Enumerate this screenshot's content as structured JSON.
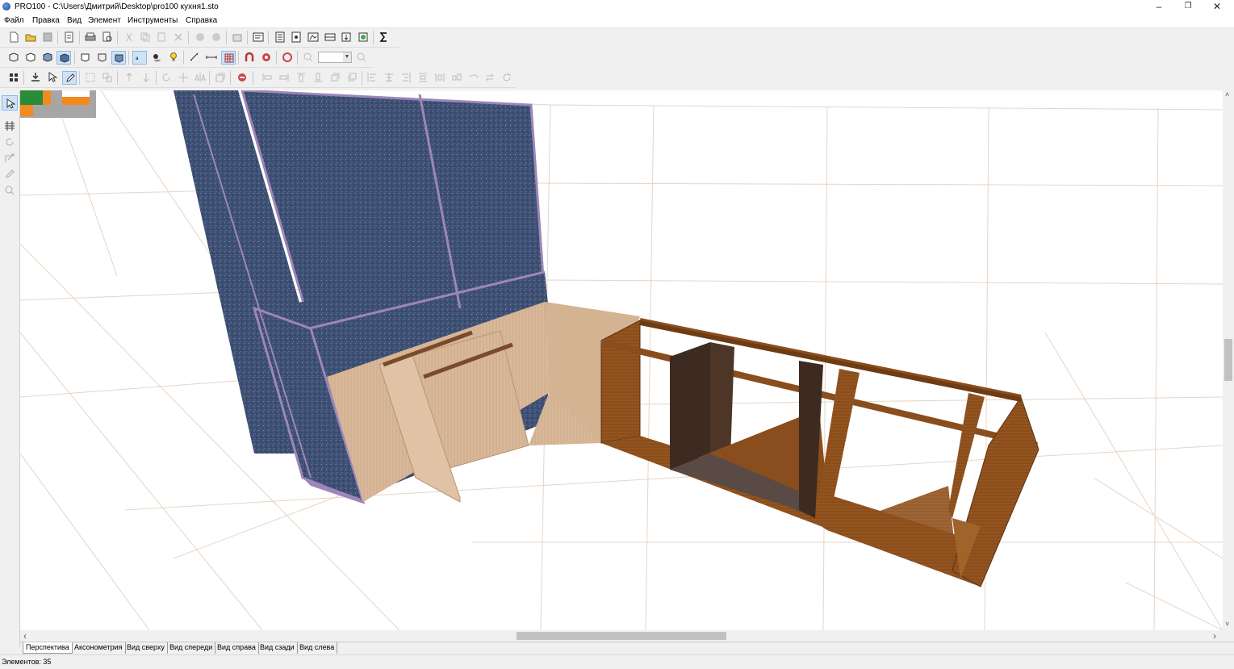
{
  "window": {
    "title": "PRO100 - C:\\Users\\Дмитрий\\Desktop\\pro100 кухня1.sto",
    "minimize": "–",
    "maximize": "❐",
    "close": "✕"
  },
  "menu": [
    "Файл",
    "Правка",
    "Вид",
    "Элемент",
    "Инструменты",
    "Справка"
  ],
  "toolbar": {
    "zoom_value": ""
  },
  "view_tabs": [
    "Перспектива",
    "Аксонометрия",
    "Вид сверху",
    "Вид спереди",
    "Вид справа",
    "Вид сзади",
    "Вид слева"
  ],
  "active_tab": "Перспектива",
  "scroll": {
    "left_arrow": "‹",
    "right_arrow": "›",
    "up_arrow": "˄",
    "down_arrow": "˅"
  },
  "status": {
    "elements": "Элементов: 35"
  },
  "colors": {
    "wall_panel": "#3d4f72",
    "panel_edge": "#9d86b8",
    "light_wood": "#d6b596",
    "dark_wood": "#8a4e1e",
    "dark_panel": "#3d2b22",
    "grid_line": "#e6d5c4"
  }
}
